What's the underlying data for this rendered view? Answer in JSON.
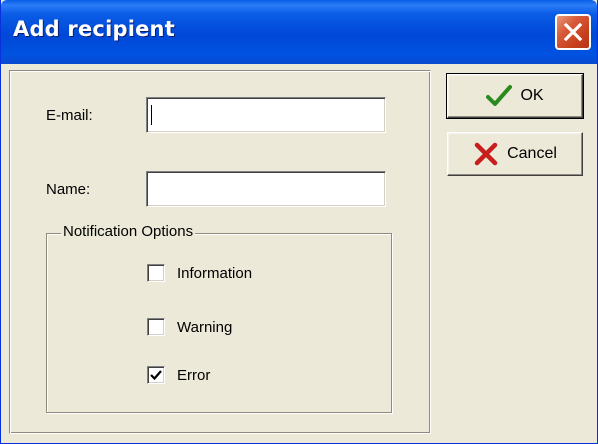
{
  "window": {
    "title": "Add recipient"
  },
  "form": {
    "email_label": "E-mail:",
    "email_value": "",
    "name_label": "Name:",
    "name_value": ""
  },
  "notifications": {
    "group_title": "Notification Options",
    "options": [
      {
        "label": "Information",
        "checked": false
      },
      {
        "label": "Warning",
        "checked": false
      },
      {
        "label": "Error",
        "checked": true
      }
    ]
  },
  "buttons": {
    "ok_label": "OK",
    "cancel_label": "Cancel"
  },
  "colors": {
    "title_bar": "#0054e3",
    "dialog_bg": "#ece9d8",
    "close_button": "#d85a3a",
    "ok_check": "#2a8a1e",
    "cancel_x": "#c81e1e"
  },
  "icons": {
    "ok": "checkmark-icon",
    "cancel": "x-icon",
    "close": "close-icon"
  }
}
